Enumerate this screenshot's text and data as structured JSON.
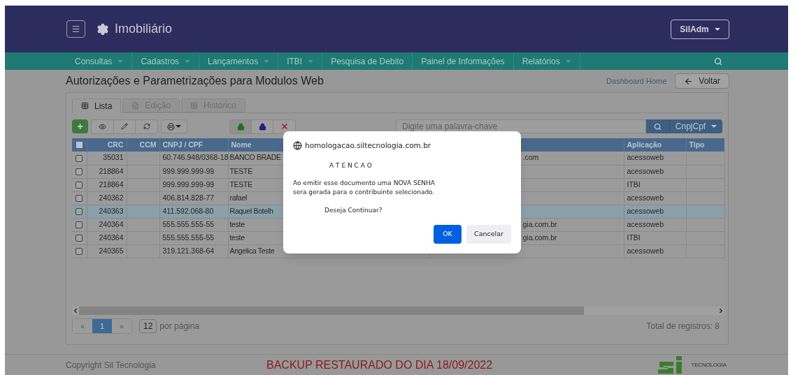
{
  "header": {
    "title": "Imobiliário",
    "user_menu": "SilAdm"
  },
  "nav": [
    {
      "label": "Consultas",
      "has_menu": true
    },
    {
      "label": "Cadastros",
      "has_menu": true
    },
    {
      "label": "Lançamentos",
      "has_menu": true
    },
    {
      "label": "ITBI",
      "has_menu": true
    },
    {
      "label": "Pesquisa de Debito",
      "has_menu": false
    },
    {
      "label": "Painel de Informações",
      "has_menu": false
    },
    {
      "label": "Relatórios",
      "has_menu": true
    }
  ],
  "page": {
    "title": "Autorizações e Parametrizações para Modulos Web",
    "dashboard_link": "Dashboard Home",
    "back_button": "Voltar"
  },
  "tabs": [
    {
      "label": "Lista",
      "selected": true,
      "kind": "table"
    },
    {
      "label": "Edição",
      "selected": false,
      "kind": "file"
    },
    {
      "label": "Histórico",
      "selected": false,
      "kind": "table"
    }
  ],
  "search": {
    "placeholder": "Digite uma palavra-chave",
    "filter": "CnpjCpf"
  },
  "toolbar": {
    "add_label": "+"
  },
  "table": {
    "all_checked": false,
    "columns": [
      "CRC",
      "CCM",
      "CNPJ / CPF",
      "Nome",
      "Aplicação",
      "Tipo"
    ],
    "rows": [
      {
        "checked": false,
        "selected": false,
        "crc": "35031",
        "cnpj_cpf": "60.746.948/0368-18",
        "nome": "BANCO BRADE",
        "column_5": ".com",
        "aplicacao": "acessoweb"
      },
      {
        "checked": false,
        "selected": false,
        "crc": "218864",
        "cnpj_cpf": "999.999.999-99",
        "nome": "TESTE",
        "aplicacao": "acessoweb"
      },
      {
        "checked": false,
        "selected": false,
        "crc": "218864",
        "cnpj_cpf": "999.999.999-99",
        "nome": "TESTE",
        "aplicacao": "ITBI"
      },
      {
        "checked": false,
        "selected": false,
        "crc": "240362",
        "cnpj_cpf": "406.814.828-77",
        "nome": "rafael",
        "aplicacao": "acessoweb"
      },
      {
        "checked": false,
        "selected": true,
        "crc": "240363",
        "cnpj_cpf": "411.592.068-80",
        "nome": "Raquel Botelh",
        "aplicacao": "acessoweb"
      },
      {
        "checked": false,
        "selected": false,
        "crc": "240364",
        "cnpj_cpf": "555.555.555-55",
        "nome": "teste",
        "column_5": "gia.com.br",
        "aplicacao": "acessoweb"
      },
      {
        "checked": false,
        "selected": false,
        "crc": "240364",
        "cnpj_cpf": "555.555.555-55",
        "nome": "teste",
        "column_5": "gia.com.br",
        "aplicacao": "ITBI"
      },
      {
        "checked": false,
        "selected": false,
        "crc": "240365",
        "cnpj_cpf": "319.121.368-64",
        "nome": "Angelica Teste",
        "aplicacao": "acessoweb"
      }
    ]
  },
  "pagination": {
    "pages": [
      {
        "label": "«",
        "selected": false
      },
      {
        "label": "1",
        "selected": true
      },
      {
        "label": "»",
        "selected": false
      }
    ],
    "page_size": "12",
    "page_size_label": "por página",
    "total": "Total de registros: 8"
  },
  "footer": {
    "copyright": "Copyright Sil Tecnologia",
    "notice": "BACKUP RESTAURADO DO DIA 18/09/2022",
    "logo_text": "TECNOLOGIA"
  },
  "dialog": {
    "origin": "homologacao.siltecnologia.com.br",
    "heading": "A T E N C A O",
    "message": [
      "Ao emitir esse documento uma NOVA SENHA",
      "sera gerada para o contribuinte selecionado."
    ],
    "question": "Deseja Continuar?",
    "buttons": [
      {
        "label": "OK",
        "kind": "primary"
      },
      {
        "label": "Cancelar",
        "kind": "secondary"
      }
    ]
  }
}
